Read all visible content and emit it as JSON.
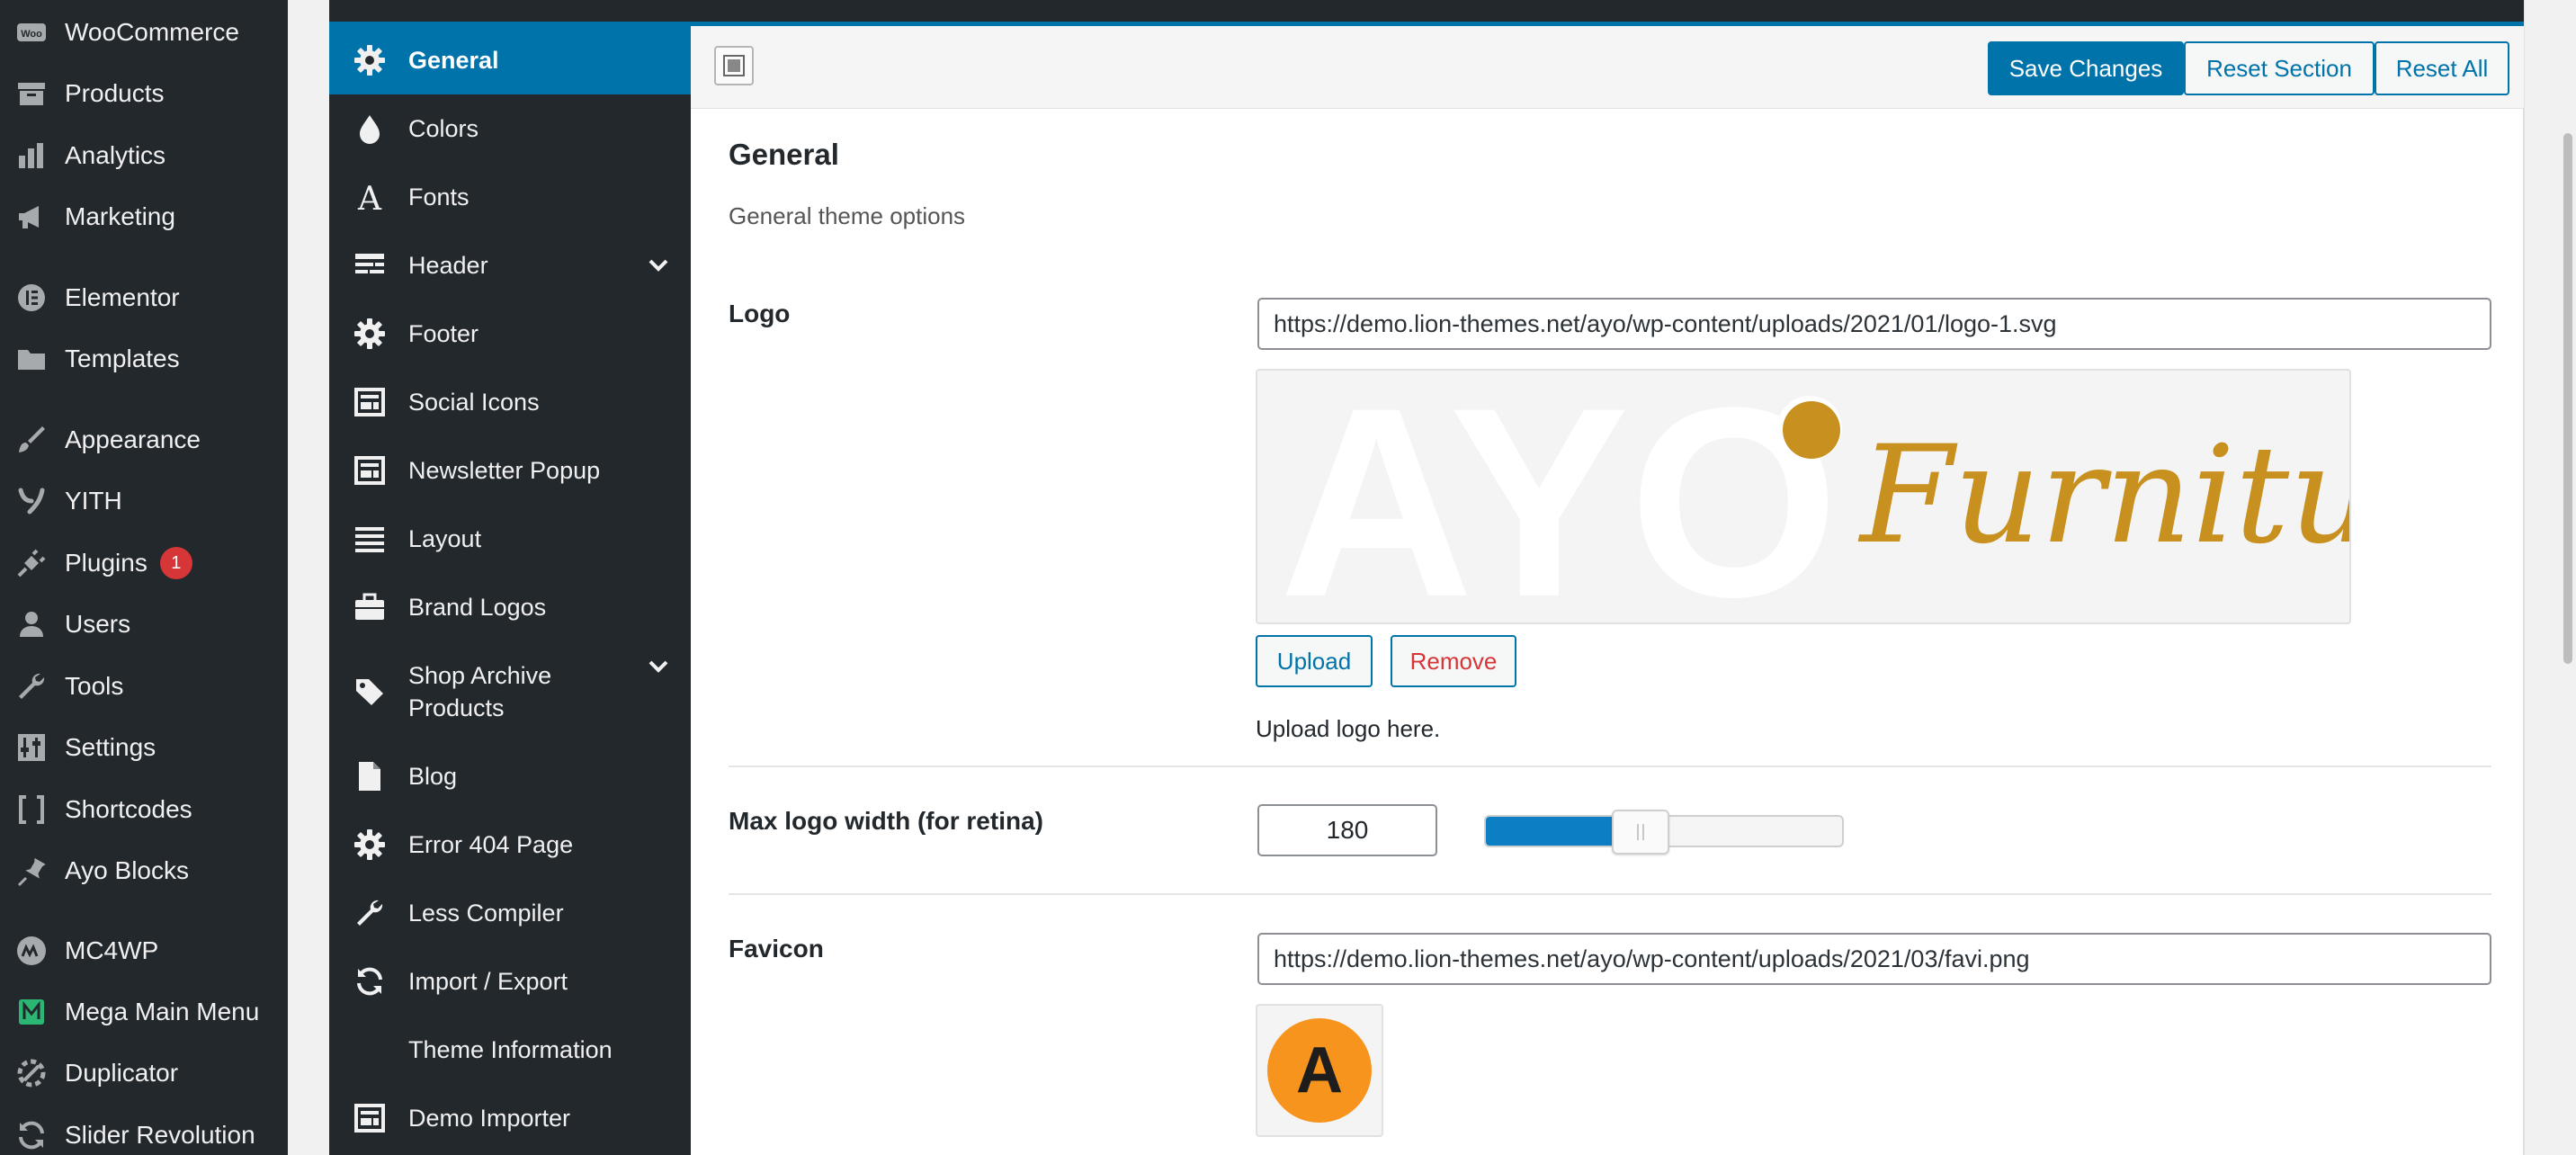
{
  "wp_menu": {
    "items": [
      {
        "label": "WooCommerce",
        "icon": "woo-icon"
      },
      {
        "label": "Products",
        "icon": "archive-icon"
      },
      {
        "label": "Analytics",
        "icon": "bar-chart-icon"
      },
      {
        "label": "Marketing",
        "icon": "megaphone-icon"
      },
      {
        "label": "Elementor",
        "icon": "elementor-icon"
      },
      {
        "label": "Templates",
        "icon": "folder-icon"
      },
      {
        "label": "Appearance",
        "icon": "paintbrush-icon"
      },
      {
        "label": "YITH",
        "icon": "yith-icon"
      },
      {
        "label": "Plugins",
        "icon": "plug-icon",
        "badge": "1"
      },
      {
        "label": "Users",
        "icon": "user-icon"
      },
      {
        "label": "Tools",
        "icon": "wrench-icon"
      },
      {
        "label": "Settings",
        "icon": "sliders-icon"
      },
      {
        "label": "Shortcodes",
        "icon": "brackets-icon"
      },
      {
        "label": "Ayo Blocks",
        "icon": "pin-icon"
      },
      {
        "label": "MC4WP",
        "icon": "mc4wp-icon"
      },
      {
        "label": "Mega Main Menu",
        "icon": "mega-menu-icon"
      },
      {
        "label": "Duplicator",
        "icon": "duplicator-icon"
      },
      {
        "label": "Slider Revolution",
        "icon": "refresh-icon"
      }
    ]
  },
  "options_sidebar": {
    "items": [
      {
        "label": "General",
        "icon": "gear-icon",
        "active": true
      },
      {
        "label": "Colors",
        "icon": "drop-icon"
      },
      {
        "label": "Fonts",
        "icon": "font-icon"
      },
      {
        "label": "Header",
        "icon": "header-icon",
        "expandable": true
      },
      {
        "label": "Footer",
        "icon": "gear-icon"
      },
      {
        "label": "Social Icons",
        "icon": "window-icon"
      },
      {
        "label": "Newsletter Popup",
        "icon": "window-icon"
      },
      {
        "label": "Layout",
        "icon": "list-icon"
      },
      {
        "label": "Brand Logos",
        "icon": "briefcase-icon"
      },
      {
        "label_line1": "Shop Archive",
        "label_line2": "Products",
        "icon": "tags-icon",
        "expandable": true
      },
      {
        "label": "Blog",
        "icon": "document-icon"
      },
      {
        "label": "Error 404 Page",
        "icon": "gear-icon"
      },
      {
        "label": "Less Compiler",
        "icon": "wrench-icon"
      },
      {
        "label": "Import / Export",
        "icon": "refresh-icon"
      },
      {
        "label": "Theme Information",
        "icon": ""
      },
      {
        "label": "Demo Importer",
        "icon": "window-icon"
      }
    ]
  },
  "toolbar": {
    "save_label": "Save Changes",
    "reset_section_label": "Reset Section",
    "reset_all_label": "Reset All"
  },
  "section": {
    "title": "General",
    "description": "General theme options"
  },
  "fields": {
    "logo": {
      "label": "Logo",
      "url": "https://demo.lion-themes.net/ayo/wp-content/uploads/2021/01/logo-1.svg",
      "upload_label": "Upload",
      "remove_label": "Remove",
      "help": "Upload logo here.",
      "watermark_text": "AYO",
      "script_text": "Furniture"
    },
    "max_logo_width": {
      "label": "Max logo width (for retina)",
      "value": "180",
      "slider_fraction": 0.36
    },
    "favicon": {
      "label": "Favicon",
      "url": "https://demo.lion-themes.net/ayo/wp-content/uploads/2021/03/favi.png",
      "letter": "A"
    }
  },
  "colors": {
    "wp_menu_bg": "#23282d",
    "accent": "#0073aa",
    "badge": "#d63638",
    "logo_gold": "#c8901f",
    "favicon_orange": "#f7941d"
  }
}
